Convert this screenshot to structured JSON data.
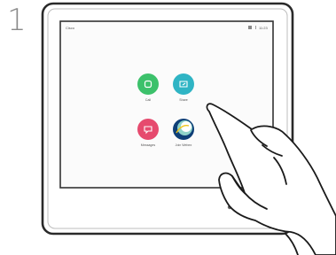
{
  "step_number": "1",
  "screen": {
    "status_left": "Cisco",
    "status_right": "11:23"
  },
  "apps": [
    {
      "label": "Call",
      "color": "#3cc16b",
      "icon": "phone-icon"
    },
    {
      "label": "Share",
      "color": "#2fb4c4",
      "icon": "share-screen-icon"
    },
    {
      "label": "Messages",
      "color": "#e64a6e",
      "icon": "message-icon"
    },
    {
      "label": "Join Webex",
      "color": "#0e3f77",
      "icon": "webex-icon"
    }
  ],
  "colors": {
    "device_frame": "#2a2a2a",
    "screen_border": "#333333",
    "hand_outline": "#1a1a1a"
  }
}
